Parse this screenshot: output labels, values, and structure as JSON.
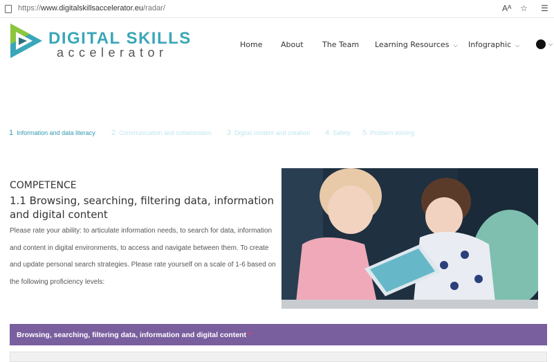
{
  "browser": {
    "url_prefix": "https://",
    "url_host": "www.digitalskillsaccelerator.eu",
    "url_path": "/radar/",
    "reader_icon": "Aᴬ",
    "favorites_icon": "☆",
    "collections_icon": "☰"
  },
  "logo": {
    "title": "DIGITAL SKILLS",
    "subtitle": "accelerator"
  },
  "nav": {
    "home": "Home",
    "about": "About",
    "team": "The Team",
    "learning": "Learning Resources",
    "infographic": "Infographic"
  },
  "steps": [
    {
      "num": "1",
      "label": "Information and data literacy"
    },
    {
      "num": "2",
      "label": "Communication and collaboration"
    },
    {
      "num": "3",
      "label": "Digital content and creation"
    },
    {
      "num": "4",
      "label": "Safety"
    },
    {
      "num": "5",
      "label": "Problem solving"
    }
  ],
  "competence": {
    "label": "COMPETENCE",
    "title": "1.1 Browsing, searching, filtering data, information and digital content",
    "description": "Please rate your ability: to articulate information needs, to search for data, information and content in digital environments, to access and navigate between them. To create and update personal search strategies. Please rate yourself on a scale of 1-6 based on the following proficiency levels:"
  },
  "question": {
    "label": "Browsing, searching, filtering data, information and digital content",
    "required_mark": "*"
  },
  "colors": {
    "accent": "#2f9ab0",
    "logo_blue": "#3aa6b9",
    "logo_green": "#8cc63f",
    "question_bar": "#7a5f9f",
    "required": "#e2445c"
  }
}
